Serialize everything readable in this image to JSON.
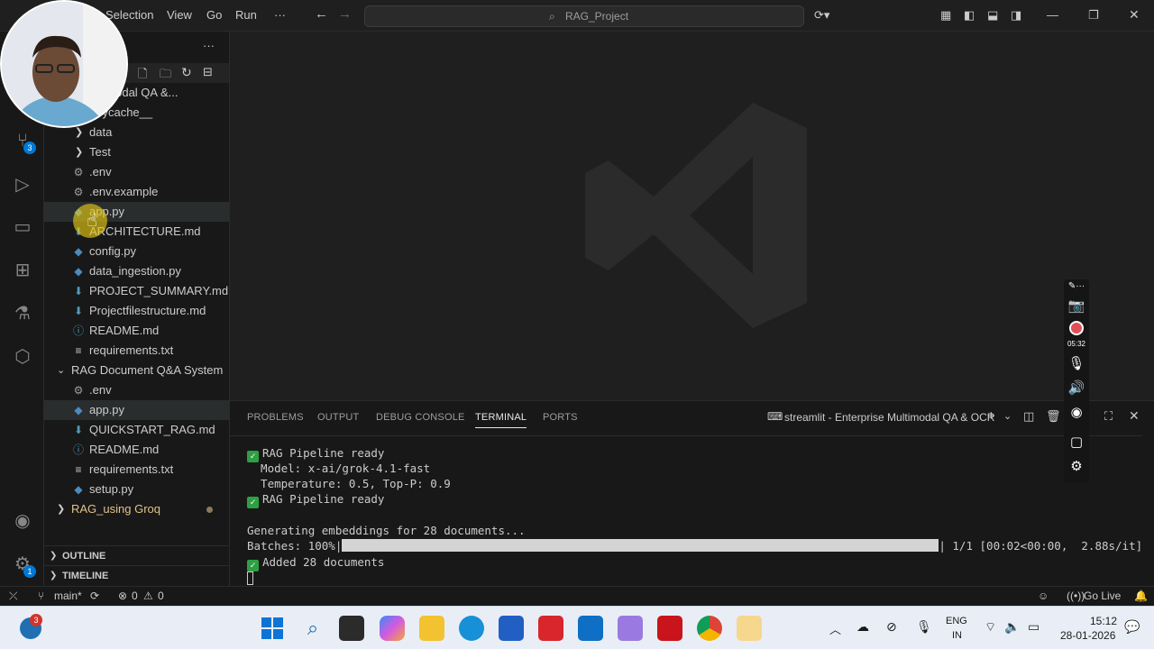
{
  "menubar": {
    "items": [
      "Selection",
      "View",
      "Go",
      "Run",
      "···"
    ],
    "search_text": "RAG_Project"
  },
  "sidebar": {
    "more_label": "···",
    "tree": [
      {
        "label": "e Multimodal QA &...",
        "indent": 1,
        "kind": "folder-open"
      },
      {
        "label": "_pycache__",
        "indent": 2,
        "kind": "folder"
      },
      {
        "label": "data",
        "indent": 2,
        "kind": "folder"
      },
      {
        "label": "Test",
        "indent": 2,
        "kind": "folder"
      },
      {
        "label": ".env",
        "indent": 2,
        "kind": "gear"
      },
      {
        "label": ".env.example",
        "indent": 2,
        "kind": "gear"
      },
      {
        "label": "app.py",
        "indent": 2,
        "kind": "python"
      },
      {
        "label": "ARCHITECTURE.md",
        "indent": 2,
        "kind": "markdown"
      },
      {
        "label": "config.py",
        "indent": 2,
        "kind": "python"
      },
      {
        "label": "data_ingestion.py",
        "indent": 2,
        "kind": "python"
      },
      {
        "label": "PROJECT_SUMMARY.md",
        "indent": 2,
        "kind": "markdown"
      },
      {
        "label": "Projectfilestructure.md",
        "indent": 2,
        "kind": "markdown"
      },
      {
        "label": "README.md",
        "indent": 2,
        "kind": "info"
      },
      {
        "label": "requirements.txt",
        "indent": 2,
        "kind": "text"
      },
      {
        "label": "RAG Document Q&A System",
        "indent": 1,
        "kind": "folder-open"
      },
      {
        "label": ".env",
        "indent": 2,
        "kind": "gear"
      },
      {
        "label": "app.py",
        "indent": 2,
        "kind": "python"
      },
      {
        "label": "QUICKSTART_RAG.md",
        "indent": 2,
        "kind": "markdown"
      },
      {
        "label": "README.md",
        "indent": 2,
        "kind": "info"
      },
      {
        "label": "requirements.txt",
        "indent": 2,
        "kind": "text"
      },
      {
        "label": "setup.py",
        "indent": 2,
        "kind": "python"
      },
      {
        "label": "RAG_using Groq",
        "indent": 1,
        "kind": "folder"
      }
    ],
    "sections": [
      "OUTLINE",
      "TIMELINE"
    ]
  },
  "activity_badges": {
    "source_control": "3",
    "settings": "1"
  },
  "panel": {
    "tabs": [
      "PROBLEMS",
      "OUTPUT",
      "DEBUG CONSOLE",
      "TERMINAL",
      "PORTS"
    ],
    "active_tab": "TERMINAL",
    "terminal_name": "streamlit - Enterprise Multimodal QA & OCR",
    "lines": [
      {
        "check": true,
        "text": "RAG Pipeline ready"
      },
      {
        "check": false,
        "text": "  Model: x-ai/grok-4.1-fast"
      },
      {
        "check": false,
        "text": "  Temperature: 0.5, Top-P: 0.9"
      },
      {
        "check": true,
        "text": "RAG Pipeline ready"
      },
      {
        "check": false,
        "text": ""
      },
      {
        "check": false,
        "text": "Generating embeddings for 28 documents..."
      },
      {
        "check": false,
        "text": "PROGRESS"
      },
      {
        "check": true,
        "text": "Added 28 documents"
      }
    ],
    "progress": {
      "prefix": "Batches: 100%|",
      "suffix": "| 1/1 [00:02<00:00,  2.88s/it]",
      "fraction": 1.0
    }
  },
  "statusbar": {
    "branch": "main*",
    "errors": "0",
    "warnings": "0",
    "go_live": "Go Live"
  },
  "recorder": {
    "time": "05:32"
  },
  "taskbar": {
    "notification_count": "3",
    "lang_top": "ENG",
    "lang_bottom": "IN",
    "time": "15:12",
    "date": "28-01-2026"
  },
  "colors": {
    "accent": "#0078d4",
    "python_icon": "#4b8bbe",
    "markdown_icon": "#519aba",
    "check_green": "#2ea043",
    "git_folder_yellow": "#e2c08d"
  }
}
